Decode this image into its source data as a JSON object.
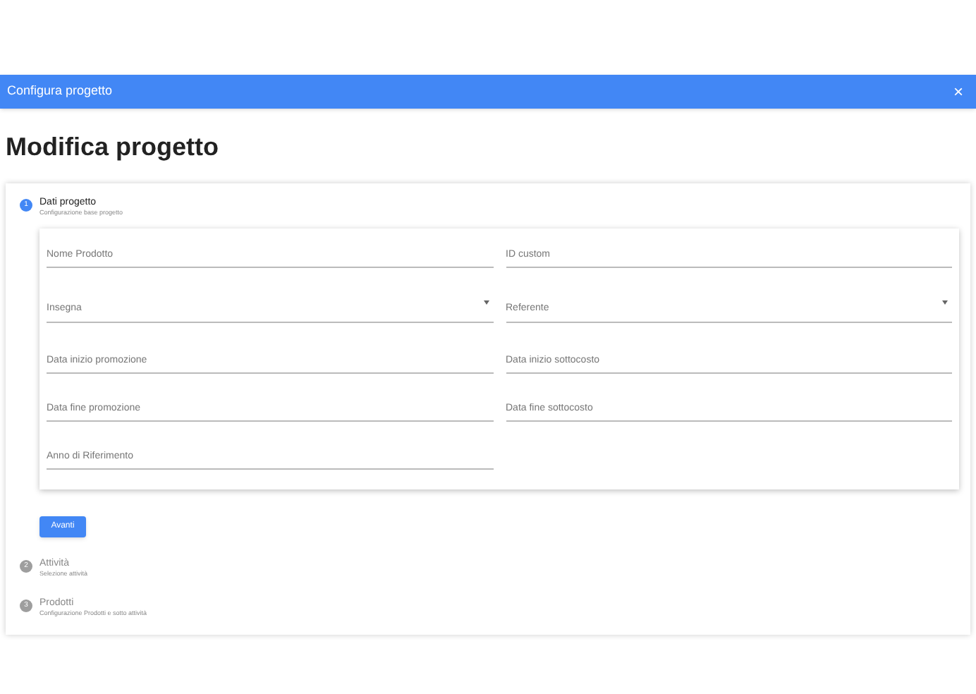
{
  "dialog": {
    "title": "Configura progetto",
    "close": "×"
  },
  "heading": "Modifica progetto",
  "steps": [
    {
      "number": "1",
      "title": "Dati progetto",
      "subtitle": "Configurazione base progetto",
      "selected": true,
      "fields": [
        {
          "kind": "text",
          "placeholder": "Nome Prodotto"
        },
        {
          "kind": "text",
          "placeholder": "ID custom"
        },
        {
          "kind": "select",
          "placeholder": "Insegna"
        },
        {
          "kind": "select",
          "placeholder": "Referente"
        },
        {
          "kind": "text",
          "placeholder": "Data inizio promozione"
        },
        {
          "kind": "text",
          "placeholder": "Data inizio sottocosto"
        },
        {
          "kind": "text",
          "placeholder": "Data fine promozione"
        },
        {
          "kind": "text",
          "placeholder": "Data fine sottocosto"
        },
        {
          "kind": "text",
          "placeholder": "Anno di Riferimento"
        }
      ],
      "button": "Avanti"
    },
    {
      "number": "2",
      "title": "Attività",
      "subtitle": "Selezione attività",
      "selected": false
    },
    {
      "number": "3",
      "title": "Prodotti",
      "subtitle": "Configurazione Prodotti e sotto attività",
      "selected": false
    }
  ]
}
